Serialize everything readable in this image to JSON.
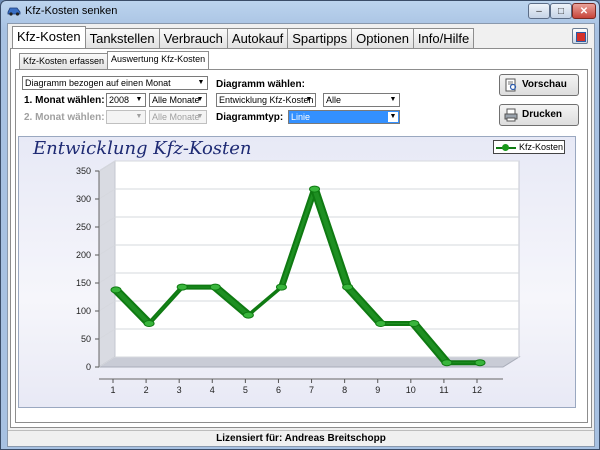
{
  "window": {
    "title": "Kfz-Kosten senken"
  },
  "main_tabs": [
    "Kfz-Kosten",
    "Tankstellen",
    "Verbrauch",
    "Autokauf",
    "Spartipps",
    "Optionen",
    "Info/Hilfe"
  ],
  "sub_tabs": [
    "Kfz-Kosten erfassen",
    "Auswertung Kfz-Kosten"
  ],
  "controls": {
    "diagram_basis": "Diagramm bezogen auf einen Monat",
    "month1_label": "1. Monat wählen:",
    "month1_year": "2008",
    "month1_month": "Alle Monate",
    "month2_label": "2. Monat wählen:",
    "month2_year": "",
    "month2_month": "Alle Monate",
    "diagram_select_label": "Diagramm wählen:",
    "diagram_select": "Entwicklung Kfz-Kosten",
    "diagram_filter": "Alle",
    "diagram_type_label": "Diagrammtyp:",
    "diagram_type": "Linie"
  },
  "buttons": {
    "preview": "Vorschau",
    "print": "Drucken"
  },
  "status": "Lizensiert für: Andreas Breitschopp",
  "chart_data": {
    "type": "line",
    "title": "Entwicklung Kfz-Kosten",
    "categories": [
      "1",
      "2",
      "3",
      "4",
      "5",
      "6",
      "7",
      "8",
      "9",
      "10",
      "11",
      "12"
    ],
    "series": [
      {
        "name": "Kfz-Kosten",
        "values": [
          135,
          75,
          140,
          140,
          90,
          140,
          315,
          140,
          75,
          75,
          5,
          5
        ]
      }
    ],
    "ylim": [
      0,
      350
    ],
    "yticks": [
      "0",
      "50",
      "100",
      "150",
      "200",
      "250",
      "300",
      "350"
    ],
    "grid": true,
    "legend": "top-right",
    "line_color": "#0f7a12"
  }
}
